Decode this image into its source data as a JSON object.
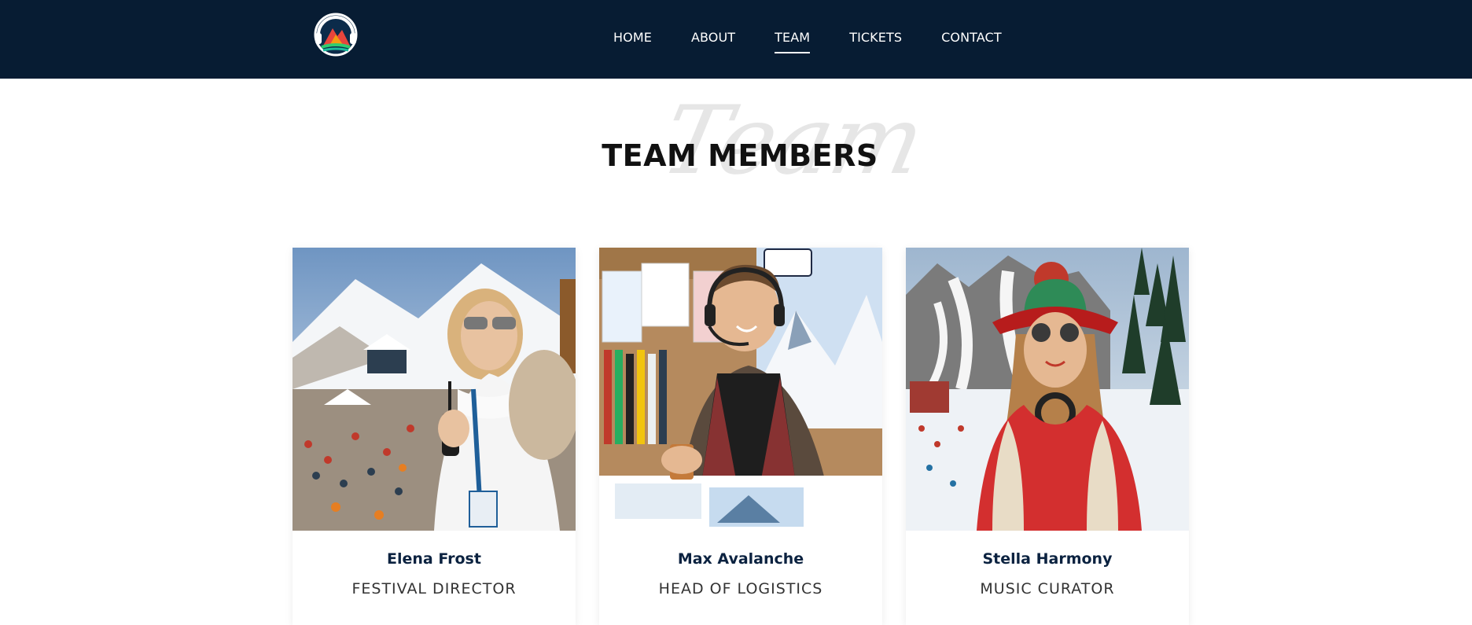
{
  "nav": {
    "items": [
      {
        "label": "HOME"
      },
      {
        "label": "ABOUT"
      },
      {
        "label": "TEAM",
        "active": true
      },
      {
        "label": "TICKETS"
      },
      {
        "label": "CONTACT"
      }
    ]
  },
  "section": {
    "script_text": "Team",
    "title": "TEAM MEMBERS"
  },
  "team": [
    {
      "name": "Elena Frost",
      "role": "FESTIVAL DIRECTOR"
    },
    {
      "name": "Max Avalanche",
      "role": "HEAD OF LOGISTICS"
    },
    {
      "name": "Stella Harmony",
      "role": "MUSIC CURATOR"
    }
  ],
  "colors": {
    "header_bg": "#071c33",
    "name_color": "#0b2240",
    "accent_red": "#c8102e"
  }
}
